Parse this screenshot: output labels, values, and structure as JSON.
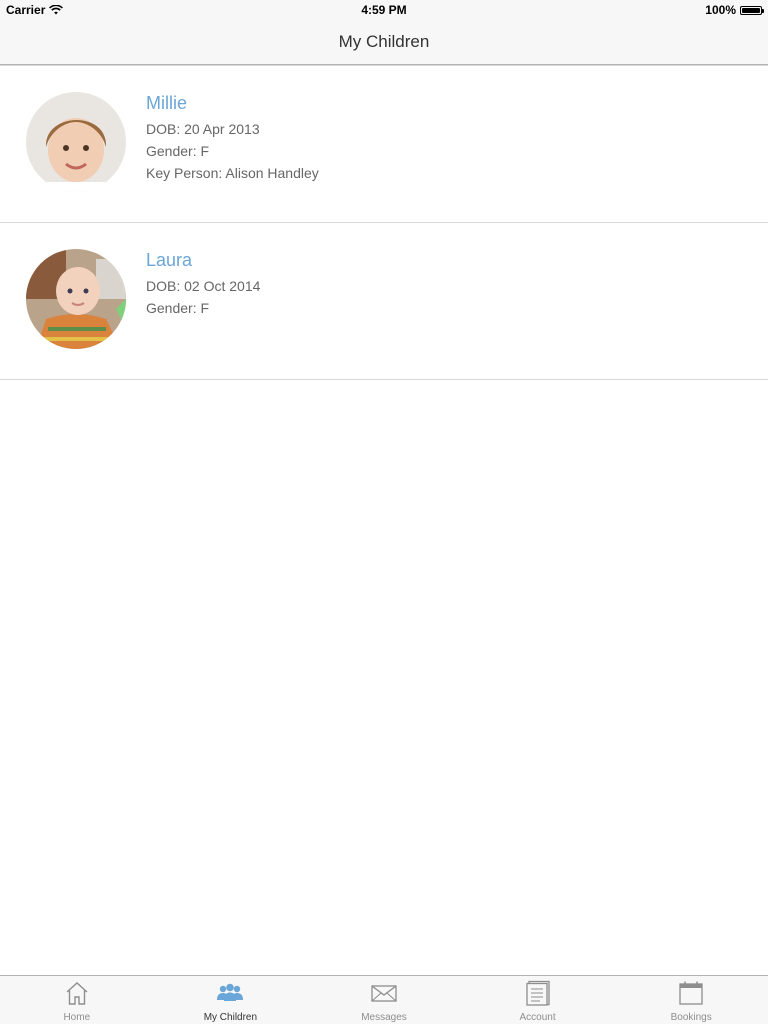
{
  "status_bar": {
    "carrier": "Carrier",
    "time": "4:59 PM",
    "battery": "100%"
  },
  "nav": {
    "title": "My Children"
  },
  "children": [
    {
      "name": "Millie",
      "dob": "DOB: 20 Apr 2013",
      "gender": "Gender: F",
      "key_person": "Key Person: Alison Handley"
    },
    {
      "name": "Laura",
      "dob": "DOB: 02 Oct 2014",
      "gender": "Gender: F"
    }
  ],
  "tabs": [
    {
      "label": "Home",
      "icon": "home-icon"
    },
    {
      "label": "My Children",
      "icon": "children-icon",
      "active": true
    },
    {
      "label": "Messages",
      "icon": "envelope-icon"
    },
    {
      "label": "Account",
      "icon": "document-icon"
    },
    {
      "label": "Bookings",
      "icon": "calendar-icon"
    }
  ],
  "colors": {
    "accent": "#6aa6d8",
    "bar_background": "#f7f7f7",
    "divider": "#d9d9d9"
  }
}
